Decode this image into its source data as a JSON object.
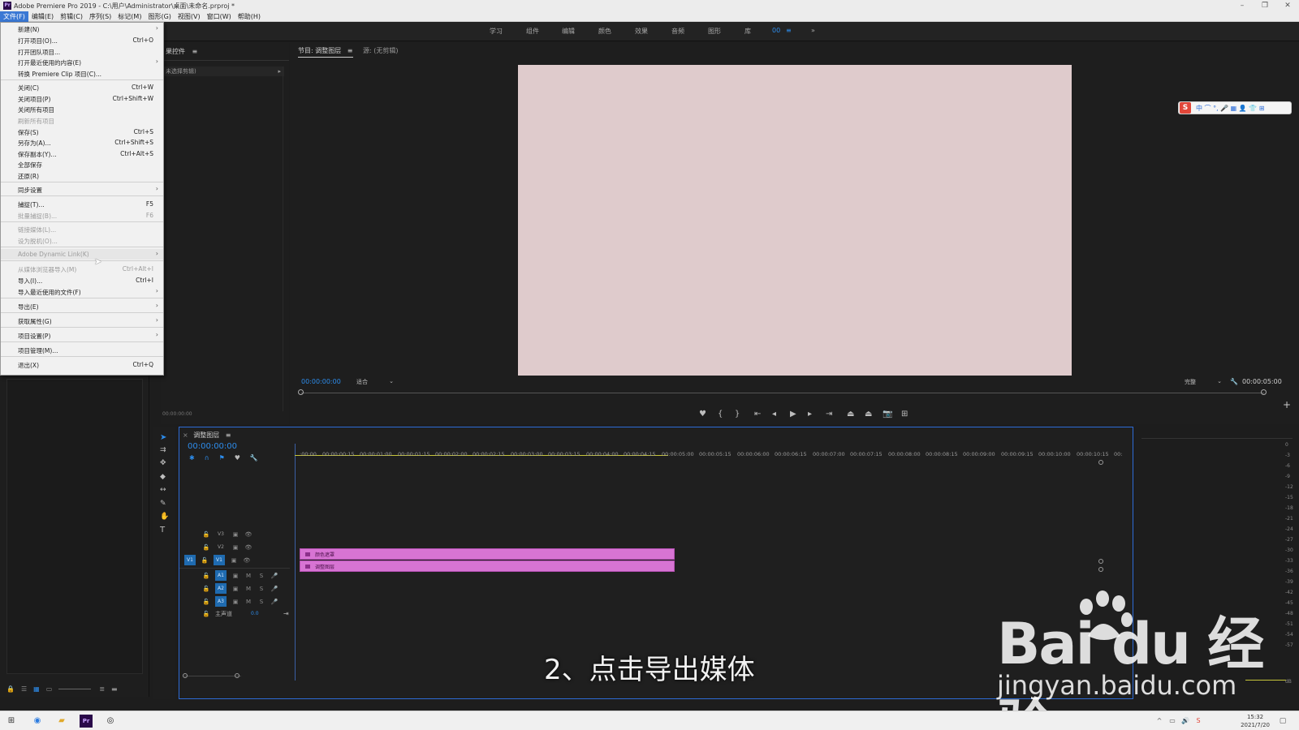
{
  "window": {
    "title": "Adobe Premiere Pro 2019 - C:\\用户\\Administrator\\桌面\\未命名.prproj *",
    "controls": [
      "–",
      "❐",
      "✕"
    ]
  },
  "menubar": {
    "items": [
      "文件(F)",
      "编辑(E)",
      "剪辑(C)",
      "序列(S)",
      "标记(M)",
      "图形(G)",
      "视图(V)",
      "窗口(W)",
      "帮助(H)"
    ]
  },
  "workspaces": {
    "items": [
      "学习",
      "组件",
      "编辑",
      "颜色",
      "效果",
      "音频",
      "图形",
      "库"
    ],
    "active": "00",
    "more": "≡",
    "overflow": "»"
  },
  "effects_panel": {
    "tab": "果控件",
    "menu": "≡",
    "subtitle": "未选择剪辑)",
    "time": "00:00:00:00"
  },
  "program_monitor": {
    "tab_program": "节目: 调整图层",
    "tab_menu": "≡",
    "tab_source": "源: (无剪辑)",
    "timecode": "00:00:00:00",
    "fit": "适合",
    "quality": "完整",
    "duration": "00:00:05:00"
  },
  "timeline": {
    "sequence_tab": "调整图层",
    "tab_menu": "≡",
    "timecode": "00:00:00:00",
    "ruler": [
      ":00:00",
      "00:00:00:15",
      "00:00:01:00",
      "00:00:01:15",
      "00:00:02:00",
      "00:00:02:15",
      "00:00:03:00",
      "00:00:03:15",
      "00:00:04:00",
      "00:00:04:15",
      "00:00:05:00",
      "00:00:05:15",
      "00:00:06:00",
      "00:00:06:15",
      "00:00:07:00",
      "00:00:07:15",
      "00:00:08:00",
      "00:00:08:15",
      "00:00:09:00",
      "00:00:09:15",
      "00:00:10:00",
      "00:00:10:15",
      "00:"
    ],
    "video_tracks": [
      "V3",
      "V2",
      "V1"
    ],
    "audio_tracks": [
      "A1",
      "A2",
      "A3"
    ],
    "master_label": "主声道",
    "master_value": "0.0",
    "clip_v2": "颜色遮罩",
    "clip_v1": "调整图层",
    "source_v": "V1"
  },
  "file_menu": {
    "items": [
      {
        "label": "新建(N)",
        "shortcut": "",
        "submenu": true,
        "disabled": false
      },
      {
        "label": "打开项目(O)...",
        "shortcut": "Ctrl+O",
        "submenu": false,
        "disabled": false
      },
      {
        "label": "打开团队项目...",
        "shortcut": "",
        "submenu": false,
        "disabled": false
      },
      {
        "label": "打开最近使用的内容(E)",
        "shortcut": "",
        "submenu": true,
        "disabled": false
      },
      {
        "label": "转换 Premiere Clip 项目(C)...",
        "shortcut": "",
        "submenu": false,
        "disabled": false
      },
      {
        "label": "关闭(C)",
        "shortcut": "Ctrl+W",
        "submenu": false,
        "disabled": false
      },
      {
        "label": "关闭项目(P)",
        "shortcut": "Ctrl+Shift+W",
        "submenu": false,
        "disabled": false
      },
      {
        "label": "关闭所有项目",
        "shortcut": "",
        "submenu": false,
        "disabled": false
      },
      {
        "label": "刷新所有项目",
        "shortcut": "",
        "submenu": false,
        "disabled": true
      },
      {
        "label": "保存(S)",
        "shortcut": "Ctrl+S",
        "submenu": false,
        "disabled": false
      },
      {
        "label": "另存为(A)...",
        "shortcut": "Ctrl+Shift+S",
        "submenu": false,
        "disabled": false
      },
      {
        "label": "保存副本(Y)...",
        "shortcut": "Ctrl+Alt+S",
        "submenu": false,
        "disabled": false
      },
      {
        "label": "全部保存",
        "shortcut": "",
        "submenu": false,
        "disabled": false
      },
      {
        "label": "还原(R)",
        "shortcut": "",
        "submenu": false,
        "disabled": false
      },
      {
        "label": "同步设置",
        "shortcut": "",
        "submenu": true,
        "disabled": false
      },
      {
        "label": "捕捉(T)...",
        "shortcut": "F5",
        "submenu": false,
        "disabled": false
      },
      {
        "label": "批量捕捉(B)...",
        "shortcut": "F6",
        "submenu": false,
        "disabled": true
      },
      {
        "label": "链接媒体(L)...",
        "shortcut": "",
        "submenu": false,
        "disabled": true
      },
      {
        "label": "设为脱机(O)...",
        "shortcut": "",
        "submenu": false,
        "disabled": true
      },
      {
        "label": "Adobe Dynamic Link(K)",
        "shortcut": "",
        "submenu": true,
        "disabled": true
      },
      {
        "label": "从媒体浏览器导入(M)",
        "shortcut": "Ctrl+Alt+I",
        "submenu": false,
        "disabled": true
      },
      {
        "label": "导入(I)...",
        "shortcut": "Ctrl+I",
        "submenu": false,
        "disabled": false
      },
      {
        "label": "导入最近使用的文件(F)",
        "shortcut": "",
        "submenu": true,
        "disabled": false
      },
      {
        "label": "导出(E)",
        "shortcut": "",
        "submenu": true,
        "disabled": false
      },
      {
        "label": "获取属性(G)",
        "shortcut": "",
        "submenu": true,
        "disabled": false
      },
      {
        "label": "项目设置(P)",
        "shortcut": "",
        "submenu": true,
        "disabled": false
      },
      {
        "label": "项目管理(M)...",
        "shortcut": "",
        "submenu": false,
        "disabled": false
      },
      {
        "label": "退出(X)",
        "shortcut": "Ctrl+Q",
        "submenu": false,
        "disabled": false
      }
    ]
  },
  "meter_ticks": [
    "0",
    "-3",
    "-6",
    "-9",
    "-12",
    "-15",
    "-18",
    "-21",
    "-24",
    "-27",
    "-30",
    "-33",
    "-36",
    "-39",
    "-42",
    "-45",
    "-48",
    "-51",
    "-54",
    "-57",
    "dB"
  ],
  "subtitle": "2、点击导出媒体",
  "watermark": {
    "logo": "Bai  du 经验",
    "url": "jingyan.baidu.com"
  },
  "ime": {
    "badge": "S",
    "icons": "中 ⌒ °, 🎤 ▦ 👤 👕 ⊞"
  },
  "taskbar": {
    "time": "15:32",
    "date": "2021/7/20"
  },
  "colors": {
    "accent": "#2d8ceb",
    "clip": "#d774d3",
    "canvas": "#dfcbcc",
    "menu_bg": "#f1f1f1"
  }
}
